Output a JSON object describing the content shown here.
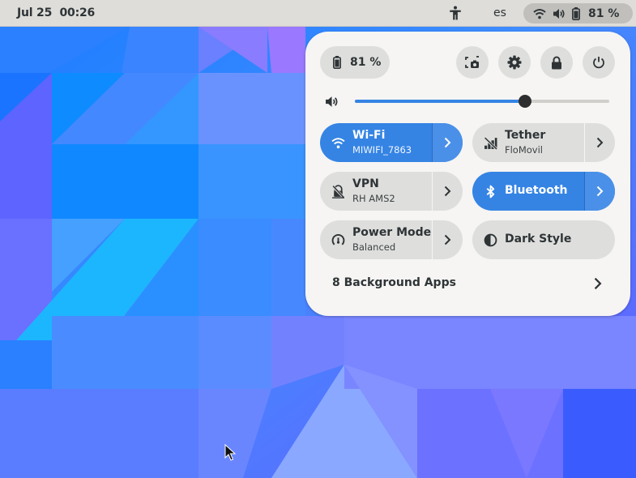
{
  "topbar": {
    "date": "Jul 25",
    "time": "00:26",
    "accessibility_icon": "accessibility-icon",
    "keyboard_layout": "es",
    "status_icons": [
      "wifi-icon",
      "volume-icon",
      "battery-icon"
    ],
    "battery_percent": "81 %"
  },
  "panel": {
    "battery": {
      "label": "81 %",
      "icon": "battery-icon"
    },
    "header_buttons": [
      {
        "name": "screenshot",
        "icon": "screenshot-icon"
      },
      {
        "name": "settings",
        "icon": "gear-icon"
      },
      {
        "name": "lock",
        "icon": "lock-icon"
      },
      {
        "name": "power",
        "icon": "power-icon"
      }
    ],
    "volume": {
      "icon": "volume-icon",
      "level_percent": 67
    },
    "tiles": [
      {
        "id": "wifi",
        "title": "Wi-Fi",
        "subtitle": "MIWIFI_7863",
        "icon": "wifi-icon",
        "active": true,
        "has_arrow": true
      },
      {
        "id": "tether",
        "title": "Tether",
        "subtitle": "FloMovil",
        "icon": "cellular-signal-off-icon",
        "active": false,
        "has_arrow": true
      },
      {
        "id": "vpn",
        "title": "VPN",
        "subtitle": "RH AMS2",
        "icon": "vpn-off-icon",
        "active": false,
        "has_arrow": true
      },
      {
        "id": "bluetooth",
        "title": "Bluetooth",
        "subtitle": "",
        "icon": "bluetooth-icon",
        "active": true,
        "has_arrow": true
      },
      {
        "id": "power-mode",
        "title": "Power Mode",
        "subtitle": "Balanced",
        "icon": "power-profile-icon",
        "active": false,
        "has_arrow": true
      },
      {
        "id": "dark-style",
        "title": "Dark Style",
        "subtitle": "",
        "icon": "dark-style-icon",
        "active": false,
        "has_arrow": false
      }
    ],
    "background_apps": {
      "label": "8 Background Apps"
    }
  },
  "colors": {
    "accent": "#3584e4",
    "panel_bg": "#f6f5f4",
    "tile_bg": "#dededd",
    "topbar_bg": "#deddda",
    "text": "#2e3436"
  }
}
